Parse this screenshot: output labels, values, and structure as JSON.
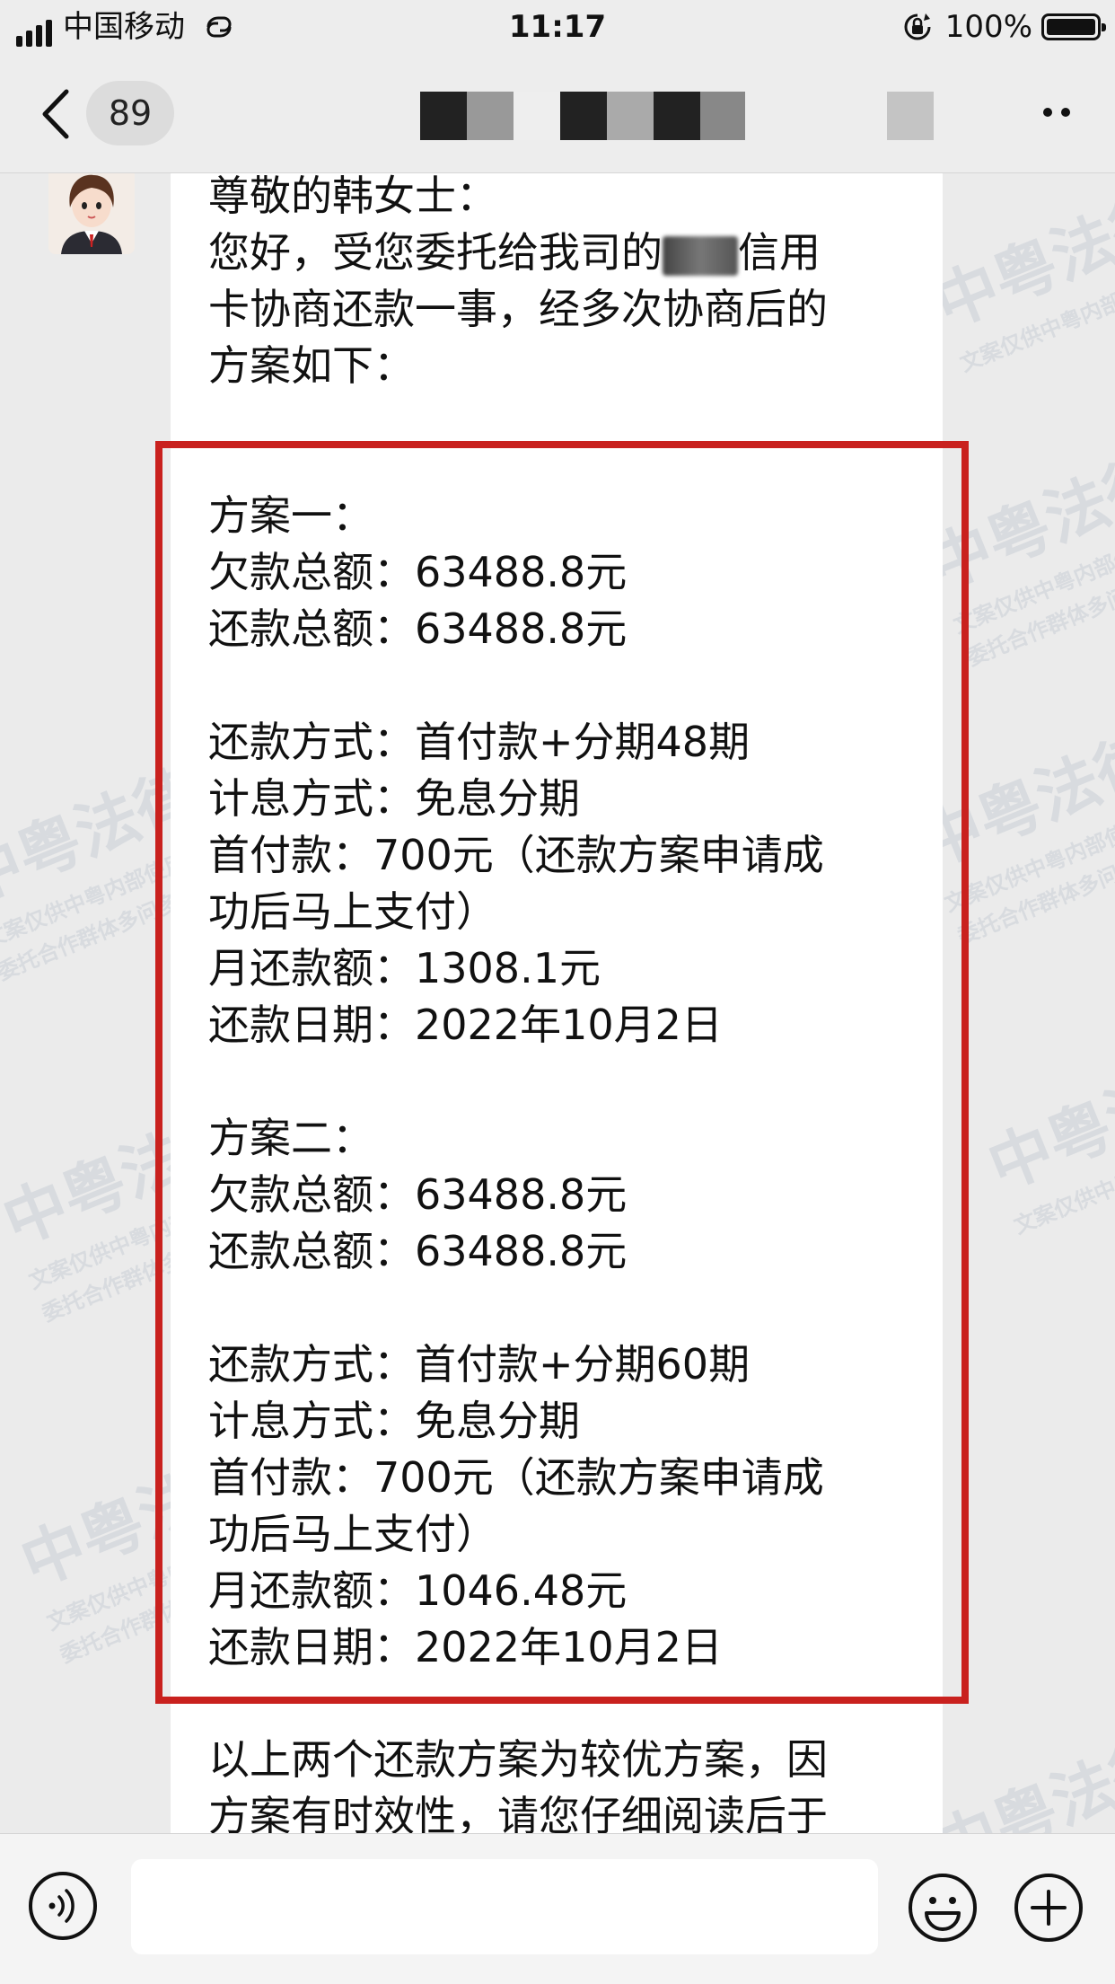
{
  "status_bar": {
    "carrier": "中国移动",
    "time": "11:17",
    "battery": "100%"
  },
  "nav": {
    "unread_count": "89",
    "icons": [
      "chevron-left-icon",
      "more-icon"
    ]
  },
  "message": {
    "greeting": "尊敬的韩女士：",
    "intro_line1_a": "您好，受您委托给我司的",
    "intro_line1_b": "信用",
    "intro_line2": "卡协商还款一事，经多次协商后的",
    "intro_line3": "方案如下：",
    "plans": [
      {
        "title": "方案一：",
        "debt_total": "欠款总额：63488.8元",
        "repay_total": "还款总额：63488.8元",
        "method": "还款方式：首付款+分期48期",
        "interest": "计息方式：免息分期",
        "down_payment_1": "首付款：700元（还款方案申请成",
        "down_payment_2": "功后马上支付）",
        "monthly": "月还款额：1308.1元",
        "date": "还款日期：2022年10月2日"
      },
      {
        "title": "方案二：",
        "debt_total": "欠款总额：63488.8元",
        "repay_total": "还款总额：63488.8元",
        "method": "还款方式：首付款+分期60期",
        "interest": "计息方式：免息分期",
        "down_payment_1": "首付款：700元（还款方案申请成",
        "down_payment_2": "功后马上支付）",
        "monthly": "月还款额：1046.48元",
        "date": "还款日期：2022年10月2日"
      }
    ],
    "footer_line1": "以上两个还款方案为较优方案，因",
    "footer_line2": "方案有时效性，请您仔细阅读后于"
  },
  "watermark": {
    "brand": "中粤法律",
    "line1": "文案仅供中粤内部使用",
    "line2": "委托合作群体多问多核实"
  },
  "input_bar": {
    "placeholder": "",
    "icons": [
      "voice-icon",
      "emoji-icon",
      "plus-icon"
    ]
  }
}
